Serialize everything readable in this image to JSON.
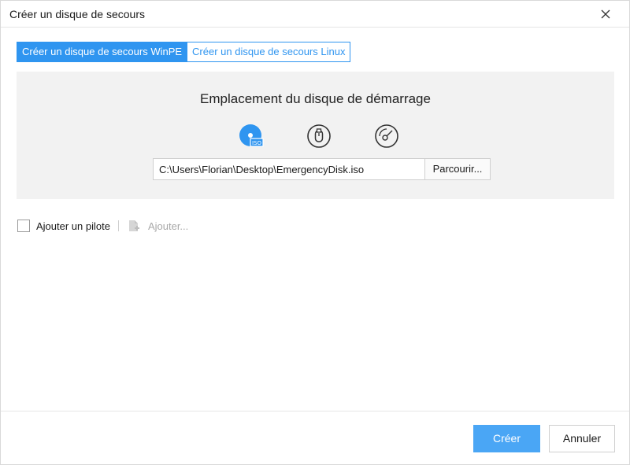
{
  "window": {
    "title": "Créer un disque de secours"
  },
  "tabs": [
    {
      "label": "Créer un disque de secours WinPE",
      "active": true
    },
    {
      "label": "Créer un disque de secours Linux",
      "active": false
    }
  ],
  "location": {
    "heading": "Emplacement du disque de démarrage",
    "options": [
      {
        "icon": "iso-disc-icon",
        "badge": "ISO",
        "selected": true
      },
      {
        "icon": "usb-drive-icon",
        "selected": false
      },
      {
        "icon": "cd-dvd-icon",
        "selected": false
      }
    ],
    "path_value": "C:\\Users\\Florian\\Desktop\\EmergencyDisk.iso",
    "browse_label": "Parcourir..."
  },
  "driver": {
    "checkbox_label": "Ajouter un pilote",
    "checked": false,
    "add_label": "Ajouter..."
  },
  "footer": {
    "create_label": "Créer",
    "cancel_label": "Annuler"
  },
  "colors": {
    "accent": "#2f95f0",
    "primary_button": "#4aa6f5",
    "panel_bg": "#f2f2f2",
    "disabled_text": "#a8a8a8"
  }
}
